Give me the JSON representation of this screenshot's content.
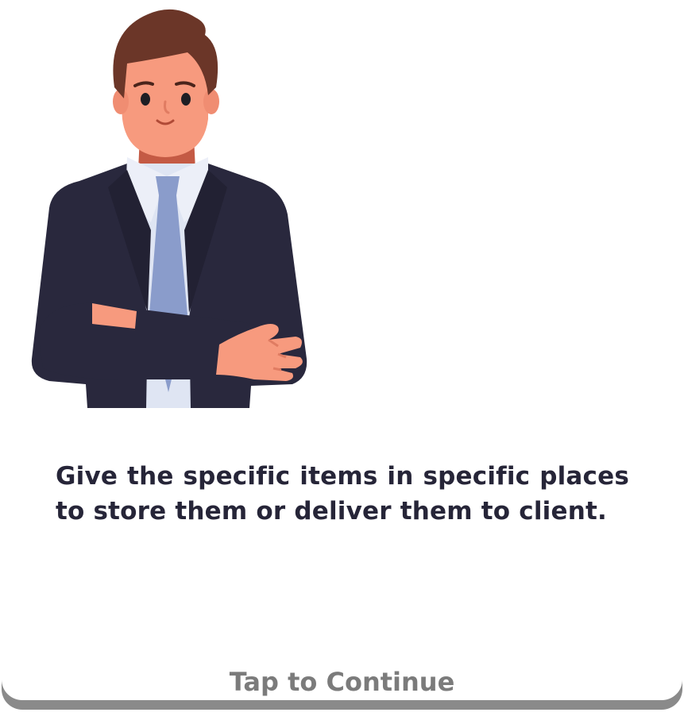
{
  "dialog": {
    "text": "Give the specific items in specific places to store them or deliver them to client."
  },
  "prompt": {
    "tap_label": "Tap to Continue"
  },
  "colors": {
    "text": "#262538",
    "tap_text": "#7b7b7b",
    "card_shadow": "#8a8a8a",
    "suit": "#29283d",
    "shirt": "#dfe5f3",
    "tie": "#8a9ccb",
    "skin": "#f79a7e",
    "hair": "#6b3628"
  },
  "icons": {
    "character": "businessman-arms-crossed-illustration"
  }
}
